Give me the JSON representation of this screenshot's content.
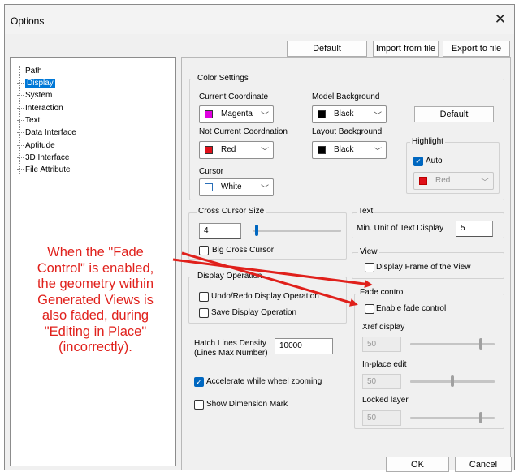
{
  "window": {
    "title": "Options"
  },
  "top_buttons": {
    "default": "Default",
    "import": "Import from file",
    "export": "Export to file"
  },
  "tree": {
    "items": [
      "Path",
      "Display",
      "System",
      "Interaction",
      "Text",
      "Data Interface",
      "Aptitude",
      "3D Interface",
      "File Attribute"
    ],
    "selected": "Display"
  },
  "color_settings": {
    "group_label": "Color Settings",
    "current_coordinate": {
      "label": "Current Coordinate",
      "value": "Magenta",
      "color": "#e000e0"
    },
    "model_background": {
      "label": "Model Background",
      "value": "Black",
      "color": "#000000"
    },
    "default_button": "Default",
    "not_current": {
      "label": "Not Current Coordnation",
      "value": "Red",
      "color": "#e0101a"
    },
    "layout_background": {
      "label": "Layout Background",
      "value": "Black",
      "color": "#000000"
    },
    "highlight": {
      "group_label": "Highlight",
      "auto_label": "Auto",
      "auto_checked": true,
      "value": "Red",
      "color": "#e0101a"
    },
    "cursor": {
      "label": "Cursor",
      "value": "White",
      "color": "#ffffff"
    }
  },
  "cross_cursor": {
    "group_label": "Cross Cursor Size",
    "value": "4",
    "slider_fraction": 0.02,
    "big_label": "Big Cross Cursor"
  },
  "text_group": {
    "group_label": "Text",
    "min_unit_label": "Min. Unit of Text Display",
    "min_unit_value": "5"
  },
  "view_group": {
    "group_label": "View",
    "frame_label": "Display Frame of the View"
  },
  "display_operation": {
    "group_label": "Display Operation",
    "undo_label": "Undo/Redo Display Operation",
    "save_label": "Save Display Operation"
  },
  "fade_control": {
    "group_label": "Fade control",
    "enable_label": "Enable fade control",
    "xref": {
      "label": "Xref display",
      "value": "50",
      "fraction": 0.85
    },
    "inplace": {
      "label": "In-place edit",
      "value": "50",
      "fraction": 0.5
    },
    "locked": {
      "label": "Locked layer",
      "value": "50",
      "fraction": 0.85
    }
  },
  "hatch": {
    "label_line1": "Hatch Lines Density",
    "label_line2": "(Lines Max Number)",
    "value": "10000"
  },
  "accelerate": {
    "label": "Accelerate while wheel zooming",
    "checked": true
  },
  "dimension_mark": {
    "label": "Show Dimension Mark",
    "checked": false
  },
  "footer": {
    "ok": "OK",
    "cancel": "Cancel"
  },
  "annotation": {
    "lines": [
      "When the \"Fade",
      "Control\" is enabled,",
      "the geometry within",
      "Generated Views is",
      "also faded, during",
      "\"Editing in Place\"",
      "(incorrectly)."
    ],
    "color": "#e0201b"
  }
}
